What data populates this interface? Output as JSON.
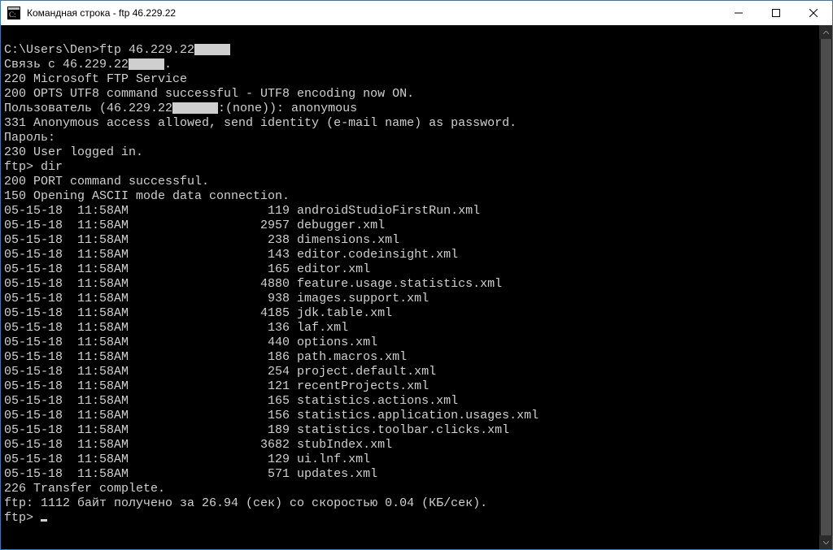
{
  "window": {
    "title": "Командная строка - ftp  46.229.22"
  },
  "terminal": {
    "prompt_line": "C:\\Users\\Den>ftp 46.229.22",
    "connect_line_prefix": "Связь с 46.229.22",
    "line_220": "220 Microsoft FTP Service",
    "line_200_opts": "200 OPTS UTF8 command successful - UTF8 encoding now ON.",
    "user_line_prefix": "Пользователь (46.229.22",
    "user_line_suffix": ":(none)): anonymous",
    "line_331": "331 Anonymous access allowed, send identity (e-mail name) as password.",
    "password_label": "Пароль:",
    "line_230": "230 User logged in.",
    "ftp_dir": "ftp> dir",
    "line_200_port": "200 PORT command successful.",
    "line_150": "150 Opening ASCII mode data connection.",
    "listing": [
      {
        "date": "05-15-18",
        "time": "11:58AM",
        "size": "119",
        "name": "androidStudioFirstRun.xml"
      },
      {
        "date": "05-15-18",
        "time": "11:58AM",
        "size": "2957",
        "name": "debugger.xml"
      },
      {
        "date": "05-15-18",
        "time": "11:58AM",
        "size": "238",
        "name": "dimensions.xml"
      },
      {
        "date": "05-15-18",
        "time": "11:58AM",
        "size": "143",
        "name": "editor.codeinsight.xml"
      },
      {
        "date": "05-15-18",
        "time": "11:58AM",
        "size": "165",
        "name": "editor.xml"
      },
      {
        "date": "05-15-18",
        "time": "11:58AM",
        "size": "4880",
        "name": "feature.usage.statistics.xml"
      },
      {
        "date": "05-15-18",
        "time": "11:58AM",
        "size": "938",
        "name": "images.support.xml"
      },
      {
        "date": "05-15-18",
        "time": "11:58AM",
        "size": "4185",
        "name": "jdk.table.xml"
      },
      {
        "date": "05-15-18",
        "time": "11:58AM",
        "size": "136",
        "name": "laf.xml"
      },
      {
        "date": "05-15-18",
        "time": "11:58AM",
        "size": "440",
        "name": "options.xml"
      },
      {
        "date": "05-15-18",
        "time": "11:58AM",
        "size": "186",
        "name": "path.macros.xml"
      },
      {
        "date": "05-15-18",
        "time": "11:58AM",
        "size": "254",
        "name": "project.default.xml"
      },
      {
        "date": "05-15-18",
        "time": "11:58AM",
        "size": "121",
        "name": "recentProjects.xml"
      },
      {
        "date": "05-15-18",
        "time": "11:58AM",
        "size": "165",
        "name": "statistics.actions.xml"
      },
      {
        "date": "05-15-18",
        "time": "11:58AM",
        "size": "156",
        "name": "statistics.application.usages.xml"
      },
      {
        "date": "05-15-18",
        "time": "11:58AM",
        "size": "189",
        "name": "statistics.toolbar.clicks.xml"
      },
      {
        "date": "05-15-18",
        "time": "11:58AM",
        "size": "3682",
        "name": "stubIndex.xml"
      },
      {
        "date": "05-15-18",
        "time": "11:58AM",
        "size": "129",
        "name": "ui.lnf.xml"
      },
      {
        "date": "05-15-18",
        "time": "11:58AM",
        "size": "571",
        "name": "updates.xml"
      }
    ],
    "line_226": "226 Transfer complete.",
    "summary_line": "ftp: 1112 байт получено за 26.94 (сек) со скоростью 0.04 (КБ/сек).",
    "ftp_prompt": "ftp> "
  }
}
